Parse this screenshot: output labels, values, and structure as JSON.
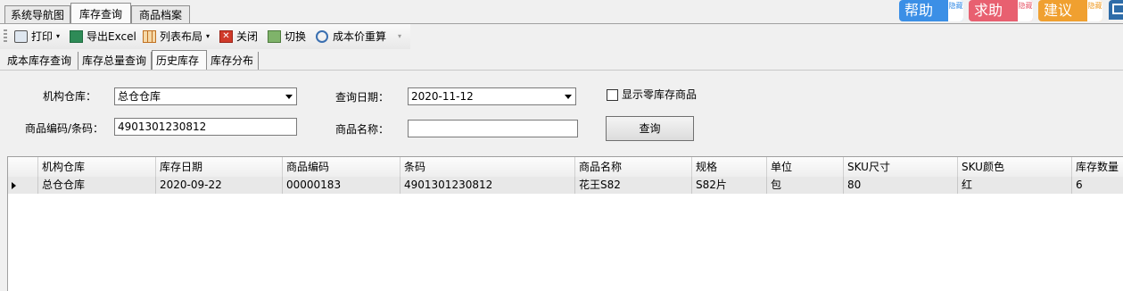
{
  "top_tabs": [
    "系统导航图",
    "库存查询",
    "商品档案"
  ],
  "help_buttons": [
    {
      "label": "帮助",
      "hide": "隐藏",
      "color": "#3b8fe6"
    },
    {
      "label": "求助",
      "hide": "隐藏",
      "color": "#e86070"
    },
    {
      "label": "建议",
      "hide": "隐藏",
      "color": "#f0a030"
    }
  ],
  "toolbar": {
    "print": "打印",
    "export": "导出Excel",
    "layout": "列表布局",
    "close": "关闭",
    "switch": "切换",
    "recalc": "成本价重算"
  },
  "sub_tabs": [
    "成本库存查询",
    "库存总量查询",
    "历史库存",
    "库存分布"
  ],
  "form": {
    "warehouse_label": "机构仓库：",
    "warehouse_value": "总仓仓库",
    "date_label": "查询日期：",
    "date_value": "2020-11-12",
    "show_zero_label": "显示零库存商品",
    "code_label": "商品编码/条码：",
    "code_value": "4901301230812",
    "name_label": "商品名称：",
    "name_value": "",
    "query_button": "查询"
  },
  "grid": {
    "columns": [
      "机构仓库",
      "库存日期",
      "商品编码",
      "条码",
      "商品名称",
      "规格",
      "单位",
      "SKU尺寸",
      "SKU颜色",
      "库存数量"
    ],
    "rows": [
      [
        "总仓仓库",
        "2020-09-22",
        "00000183",
        "4901301230812",
        "花王S82",
        "S82片",
        "包",
        "80",
        "红",
        "6"
      ]
    ]
  }
}
